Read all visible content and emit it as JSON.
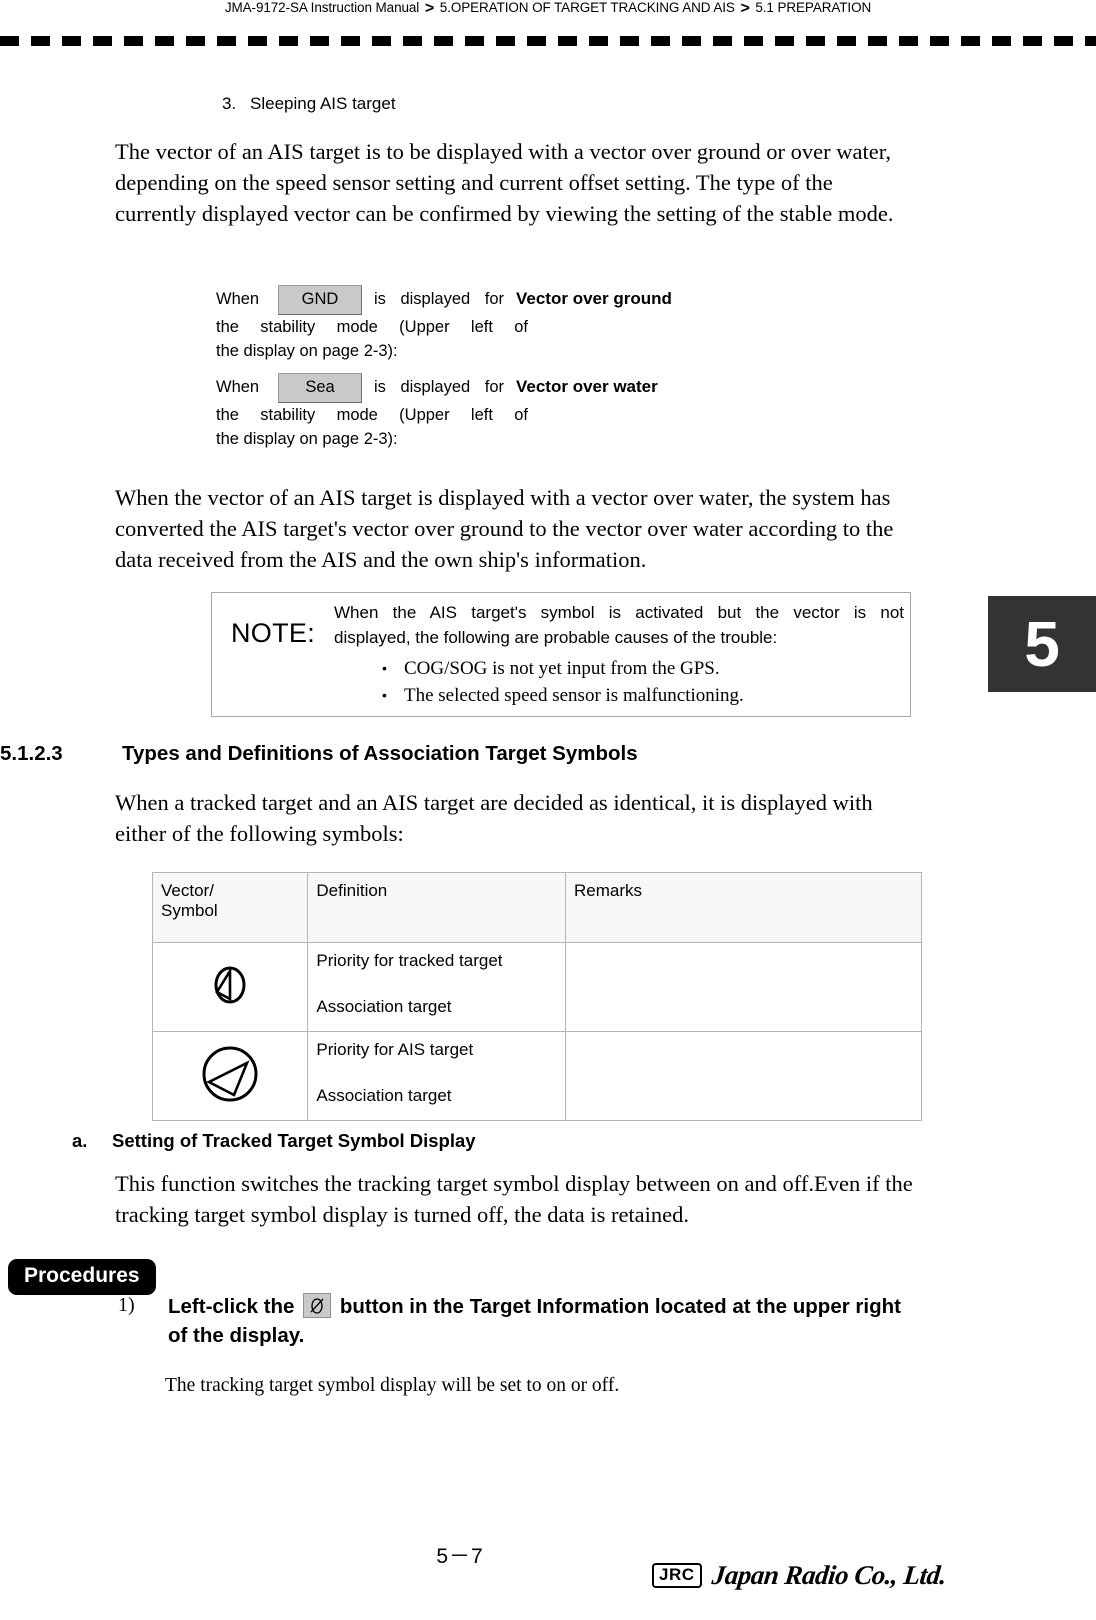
{
  "header": {
    "manual": "JMA-9172-SA Instruction Manual",
    "sep": ">",
    "crumb1": "5.OPERATION OF TARGET TRACKING AND AIS",
    "crumb2": "5.1  PREPARATION"
  },
  "chapter_tab": {
    "number": "5"
  },
  "list_item_3": {
    "num": "3.",
    "label": "Sleeping AIS target"
  },
  "para1": "The vector of an AIS target is to be displayed with a vector over ground or over water, depending on the speed sensor setting and current offset setting. The type of the currently displayed vector can be confirmed by viewing the setting of the stable mode.",
  "when_blocks": [
    {
      "when": "When",
      "key": "GND",
      "tail": "is displayed for",
      "desc": "Vector over ground",
      "line2": "the stability mode (Upper left of",
      "line3": "the display on page 2-3):"
    },
    {
      "when": "When",
      "key": "Sea",
      "tail": "is displayed for",
      "desc": "Vector over water",
      "line2": "the stability mode (Upper left of",
      "line3": "the display on page 2-3):"
    }
  ],
  "para2": "When the vector of an AIS target is displayed with a vector over water, the system has converted the AIS target's vector over ground to the vector over water according to the data received from the AIS and the own ship's information.",
  "note": {
    "label": "NOTE:",
    "line1": "When the AIS target's symbol is activated but the vector is not",
    "line2": "displayed, the following are probable causes of the trouble:",
    "bullets": [
      "COG/SOG is not yet input from the GPS.",
      "The selected speed sensor is malfunctioning."
    ],
    "bullet_glyph": "•"
  },
  "section": {
    "number": "5.1.2.3",
    "title": "Types and Definitions of Association Target Symbols"
  },
  "para3": "When a tracked target and an AIS target are decided as identical, it is displayed with either of the following symbols:",
  "table": {
    "headers": [
      "Vector/\nSymbol",
      "Definition",
      "Remarks"
    ],
    "header_col1_line1": "Vector/",
    "header_col1_line2": "Symbol",
    "header_col2": "Definition",
    "header_col3": "Remarks",
    "rows": [
      {
        "symbol": "association-tracked-priority-symbol",
        "definition_line1": "Priority for tracked target",
        "definition_line2": "Association target",
        "remarks": ""
      },
      {
        "symbol": "association-ais-priority-symbol",
        "definition_line1": "Priority for AIS target",
        "definition_line2": "Association target",
        "remarks": ""
      }
    ]
  },
  "subsection_a": {
    "label": "a.",
    "title": "Setting of Tracked Target Symbol Display"
  },
  "para4": "This function switches the tracking target symbol display between on and off.Even if the tracking target symbol display is turned off, the data is retained.",
  "procedures": {
    "badge": "Procedures",
    "step1_num": "1)",
    "step1_text_before": "Left-click the",
    "step1_text_after": "button in the Target Information located at the upper right of the display.",
    "step1_icon": "tracked-target-symbol-button"
  },
  "para5": "The tracking target symbol display will be set to on or off.",
  "footer": {
    "page_number": "5－7",
    "logo_mark": "JRC",
    "logo_name": "Japan Radio Co., Ltd."
  }
}
